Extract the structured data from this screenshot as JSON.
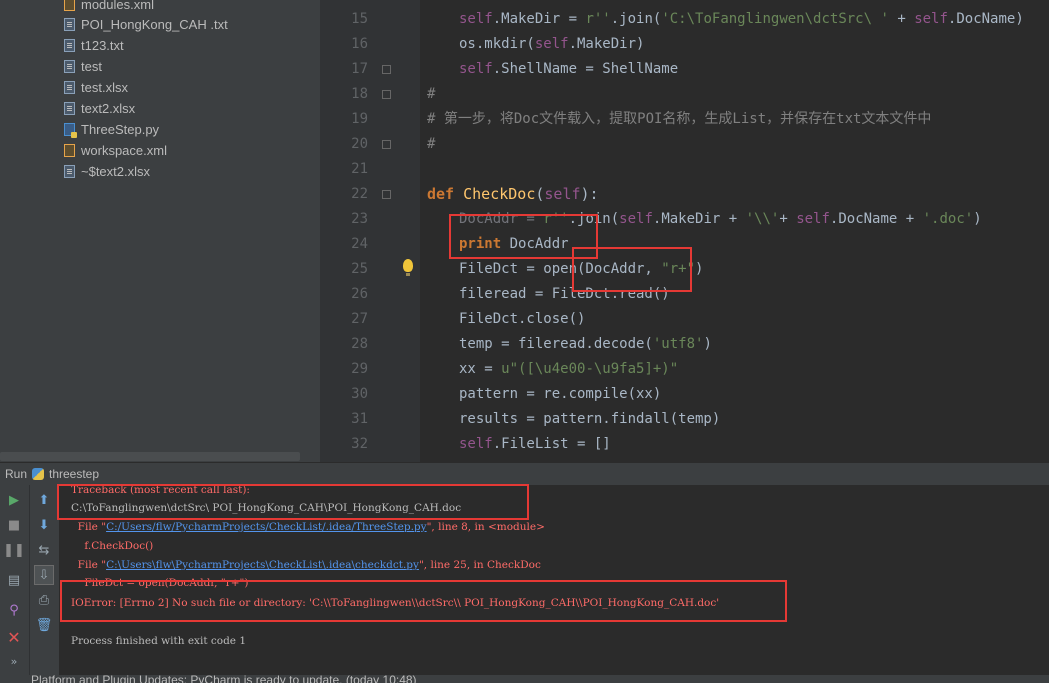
{
  "project_tree": {
    "items": [
      {
        "label": "modules.xml",
        "icon": "xml-file-icon",
        "kind": "xml"
      },
      {
        "label": "POI_HongKong_CAH .txt",
        "icon": "text-file-icon",
        "kind": "txt"
      },
      {
        "label": "t123.txt",
        "icon": "text-file-icon",
        "kind": "txt"
      },
      {
        "label": "test",
        "icon": "text-file-icon",
        "kind": "test"
      },
      {
        "label": "test.xlsx",
        "icon": "text-file-icon",
        "kind": "txt"
      },
      {
        "label": "text2.xlsx",
        "icon": "text-file-icon",
        "kind": "txt"
      },
      {
        "label": "ThreeStep.py",
        "icon": "python-file-icon",
        "kind": "py"
      },
      {
        "label": "workspace.xml",
        "icon": "xml-file-icon",
        "kind": "xml"
      },
      {
        "label": "~$text2.xlsx",
        "icon": "text-file-icon",
        "kind": "txt"
      }
    ]
  },
  "editor": {
    "line_numbers": [
      "15",
      "16",
      "17",
      "18",
      "19",
      "20",
      "21",
      "22",
      "23",
      "24",
      "25",
      "26",
      "27",
      "28",
      "29",
      "30",
      "31",
      "32"
    ],
    "code": {
      "l15": {
        "indent": "    ",
        "self": "self",
        "a": ".MakeDir = ",
        "b": "r",
        "s": "'C:\\ToFanglingwen\\dctSrc\\ '",
        "c": " + ",
        "self2": "self",
        "d": ".DocName)",
        "pre": ".join("
      },
      "l16": {
        "text": "os.mkdir(",
        "self": "self",
        "rest": ".MakeDir)"
      },
      "l17": {
        "self": "self",
        "rest": ".ShellName = ShellName"
      },
      "l18": "#",
      "l19": "# 第一步，将Doc文件载入，提取POI名称，生成List，并保存在txt文本文件中",
      "l20": "#",
      "l22": {
        "kw": "def",
        "fn": "CheckDoc",
        "rest": "(",
        "self": "self",
        "end": "):"
      },
      "l23": {
        "a": "DocAddr = ",
        "r": "r",
        "s1": "''",
        "b": ".join(",
        "self": "self",
        "c": ".MakeDir + ",
        "s2": "'\\\\'",
        "d": "+ ",
        "self2": "self",
        "e": ".DocName + ",
        "s3": "'.doc'",
        "f": ")"
      },
      "l24": {
        "kw": "print",
        "rest": " DocAddr"
      },
      "l25": {
        "a": "FileDct = open(DocAddr, ",
        "s": "\"r+\"",
        "b": ")"
      },
      "l26": "fileread = FileDct.read()",
      "l27": "FileDct.close()",
      "l28": {
        "a": "temp = fileread.decode(",
        "s": "'utf8'",
        "b": ")"
      },
      "l29": {
        "a": "xx = ",
        "s": "u\"([\\u4e00-\\u9fa5]+)\""
      },
      "l30": "pattern = re.compile(xx)",
      "l31": "results = pattern.findall(temp)",
      "l32": {
        "self": "self",
        "rest": ".FileList = []"
      }
    }
  },
  "run_panel": {
    "tab_label": "Run",
    "config_name": "threestep",
    "console": {
      "traceback": "Traceback (most recent call last):",
      "printed_path": "C:\\ToFanglingwen\\dctSrc\\ POI_HongKong_CAH\\POI_HongKong_CAH.doc",
      "frame1_pre": "  File \"",
      "frame1_link": "C:/Users/flw/PycharmProjects/CheckList/.idea/ThreeStep.py",
      "frame1_post": "\", line 8, in <module>",
      "frame1_code": "    f.CheckDoc()",
      "frame2_pre": "  File \"",
      "frame2_link": "C:\\Users\\flw\\PycharmProjects\\CheckList\\.idea\\checkdct.py",
      "frame2_post": "\", line 25, in CheckDoc",
      "frame2_code": "    FileDct = open(DocAddr, \"r+\")",
      "error": "IOError: [Errno 2] No such file or directory: 'C:\\\\ToFanglingwen\\\\dctSrc\\\\ POI_HongKong_CAH\\\\POI_HongKong_CAH.doc'",
      "exit": "Process finished with exit code 1"
    }
  },
  "status_bar": {
    "text": "Platform and Plugin Updates: PyCharm is ready to update. (today 10:48)"
  },
  "colors": {
    "keyword": "#cc7832",
    "self": "#94558d",
    "string": "#6a8759",
    "comment": "#808080",
    "function": "#ffc66d",
    "error_text": "#ff6b68",
    "link": "#5394ec",
    "highlight_box": "#e53935"
  }
}
